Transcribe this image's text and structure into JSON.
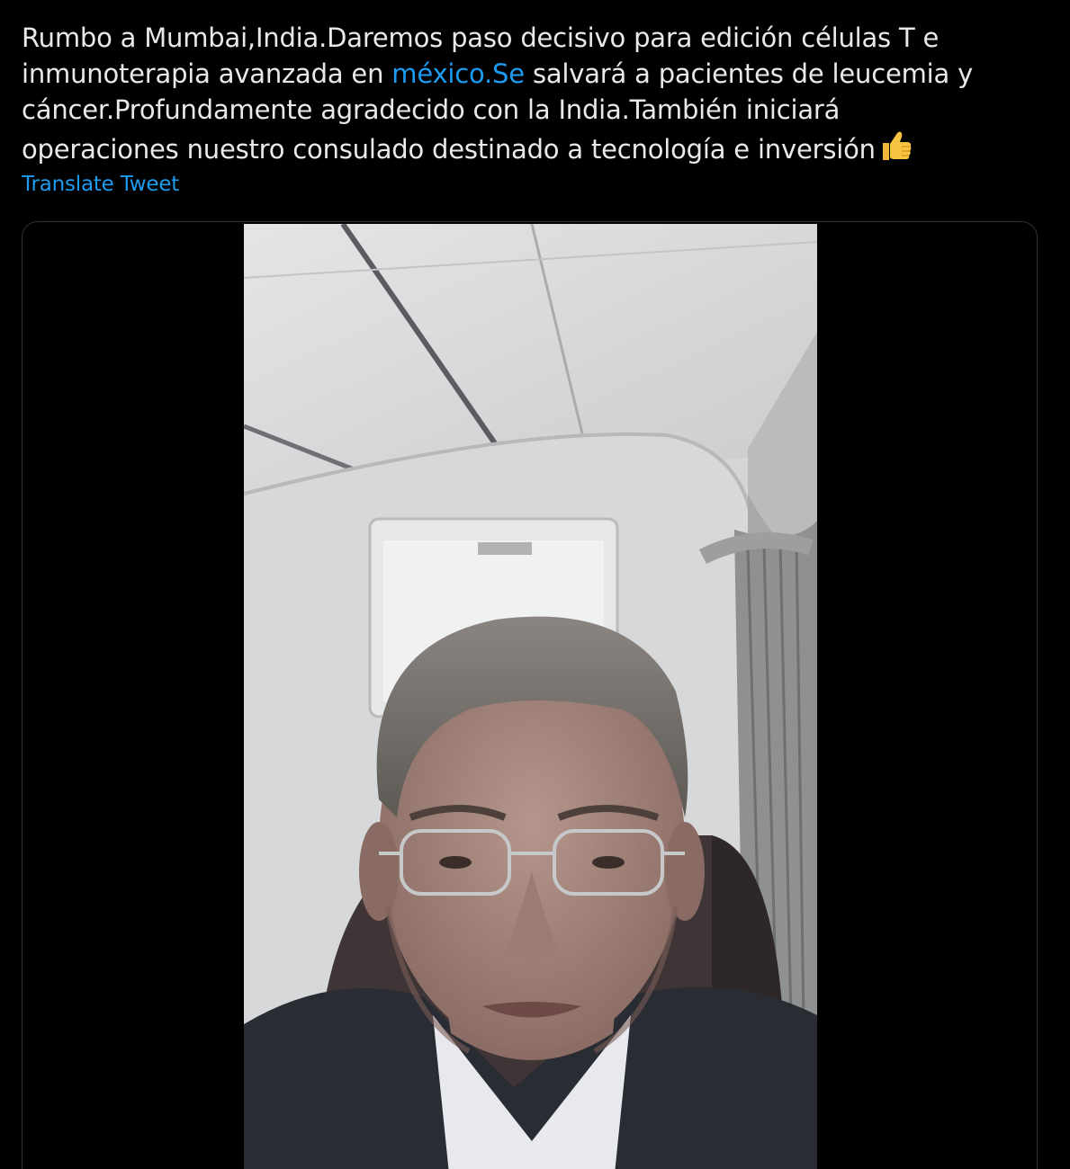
{
  "tweet": {
    "lines": [
      {
        "pre": "Rumbo a Mumbai,India.Daremos paso decisivo para edición células T e"
      },
      {
        "pre": "inmunoterapia avanzada en ",
        "link": "méxico.Se",
        "post": " salvará a pacientes de leucemia y"
      },
      {
        "pre": "cáncer.Profundamente agradecido con la India.También iniciará"
      },
      {
        "pre": "operaciones nuestro consulado destinado a tecnología e inversión",
        "emoji": "👍"
      }
    ],
    "translate_label": "Translate Tweet"
  },
  "media": {
    "type": "video",
    "icon": "thumbs-up-icon"
  },
  "colors": {
    "background": "#000000",
    "text": "#e7e9ea",
    "link": "#1d9bf0",
    "border": "#2f3336",
    "emoji": "#f6c343"
  }
}
